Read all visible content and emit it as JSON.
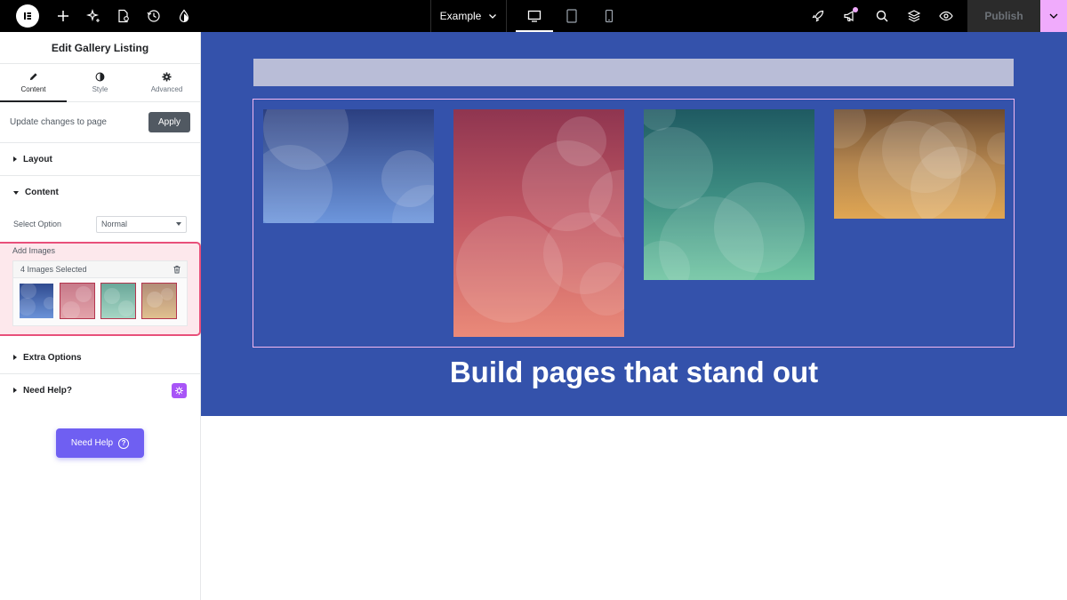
{
  "topbar": {
    "page_name": "Example",
    "publish_label": "Publish"
  },
  "panel": {
    "title": "Edit Gallery Listing",
    "tabs": [
      {
        "label": "Content",
        "icon": "pencil-icon"
      },
      {
        "label": "Style",
        "icon": "contrast-icon"
      },
      {
        "label": "Advanced",
        "icon": "gear-icon"
      }
    ],
    "update_text": "Update changes to page",
    "apply_label": "Apply",
    "sections": {
      "layout": "Layout",
      "content": "Content",
      "extra": "Extra Options",
      "help": "Need Help?"
    },
    "select_option": {
      "label": "Select Option",
      "value": "Normal"
    },
    "add_images": {
      "label": "Add Images",
      "selected_text": "4 Images Selected",
      "thumbnails": [
        "blue-gradient",
        "pink-gradient",
        "teal-gradient",
        "orange-gradient"
      ]
    },
    "need_help_button": "Need Help"
  },
  "canvas": {
    "headline": "Build pages that stand out",
    "gallery_images": [
      "blue-gradient",
      "red-gradient",
      "teal-gradient",
      "gold-gradient"
    ]
  },
  "colors": {
    "canvas_bg": "#3452ab",
    "accent_pink": "#f0abfc",
    "need_help_purple": "#6f5ff2",
    "highlight_red": "#e8507a"
  }
}
